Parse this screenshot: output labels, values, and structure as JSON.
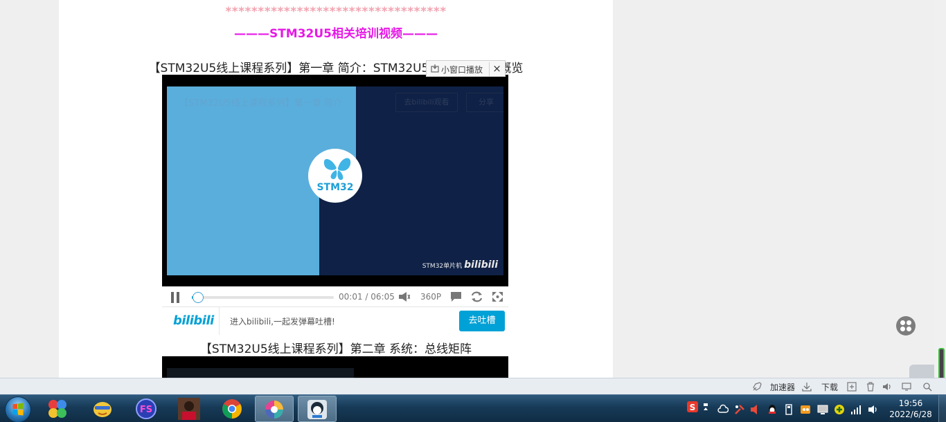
{
  "article": {
    "stars": "**********************************",
    "heading": "———STM32U5相关培训视频———",
    "video1_title": "【STM32U5线上课程系列】第一章 简介：STM32U5超低功耗产品概览",
    "video2_title": "【STM32U5线上课程系列】第二章 系统：总线矩阵"
  },
  "player": {
    "overlay_title": "【STM32U5线上课程系列】第一章 简介",
    "overlay_btn_a": "去bilibili观看",
    "overlay_btn_b": "分享",
    "logo_text": "STM32",
    "watermark_text": "STM32单片机",
    "watermark_brand": "bilibili",
    "mini_window_label": "小窗口播放",
    "mini_window_close": "×",
    "time_current": "00:01",
    "time_sep": "/",
    "time_total": "06:05",
    "progress": 0.003,
    "quality": "360P",
    "bili_logo": "bilibili",
    "bili_text": "进入bilibili,一起发弹幕吐槽!",
    "bili_button": "去吐槽"
  },
  "statusbar": {
    "accelerator": "加速器",
    "download": "下载"
  },
  "taskbar": {
    "apps": [
      "multicolor-app",
      "qq-game-app",
      "fs-app",
      "avatar-app",
      "chrome-app",
      "color-wheel-app",
      "penguin-app"
    ],
    "clock_time": "19:56",
    "clock_date": "2022/6/28"
  },
  "colors": {
    "heading": "#e619e6",
    "stars": "#f2a3b0",
    "bili_blue": "#00a1d6",
    "video_dark": "#0f2146",
    "video_light": "#5aaedc"
  }
}
